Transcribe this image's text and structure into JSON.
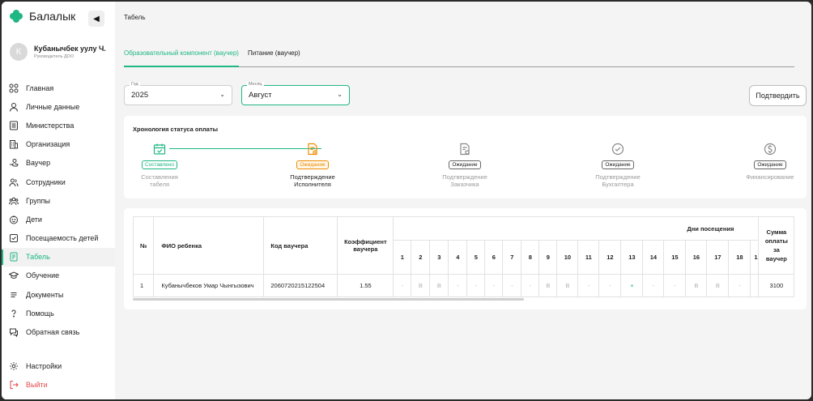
{
  "app": {
    "name": "Балалык"
  },
  "profile": {
    "initial": "К",
    "name": "Кубанычбек уулу Ч.",
    "role": "Руководитель ДОО"
  },
  "nav": {
    "items": [
      {
        "label": "Главная",
        "icon": "grid-icon"
      },
      {
        "label": "Личные данные",
        "icon": "user-icon"
      },
      {
        "label": "Министерства",
        "icon": "list-icon"
      },
      {
        "label": "Организация",
        "icon": "building-icon"
      },
      {
        "label": "Ваучер",
        "icon": "hand-icon"
      },
      {
        "label": "Сотрудники",
        "icon": "staff-icon"
      },
      {
        "label": "Группы",
        "icon": "group-icon"
      },
      {
        "label": "Дети",
        "icon": "child-icon"
      },
      {
        "label": "Посещаемость детей",
        "icon": "check-square-icon"
      },
      {
        "label": "Табель",
        "icon": "timesheet-icon",
        "active": true
      },
      {
        "label": "Обучение",
        "icon": "graduation-icon"
      },
      {
        "label": "Документы",
        "icon": "document-icon"
      },
      {
        "label": "Помощь",
        "icon": "help-icon"
      },
      {
        "label": "Обратная связь",
        "icon": "chat-icon"
      }
    ],
    "bottom": [
      {
        "label": "Настройки",
        "icon": "gear-icon"
      },
      {
        "label": "Выйти",
        "icon": "logout-icon"
      }
    ]
  },
  "breadcrumb": "Табель",
  "tabs": [
    {
      "label": "Образовательный компонент (ваучер)",
      "active": true
    },
    {
      "label": "Питание (ваучер)",
      "active": false
    }
  ],
  "filters": {
    "year": {
      "label": "Год",
      "value": "2025"
    },
    "month": {
      "label": "Месяц",
      "value": "Август"
    }
  },
  "confirm_button": "Подтвердить",
  "timeline": {
    "title": "Хронология статуса оплаты",
    "steps": [
      {
        "badge": "Составлено",
        "status": "done",
        "label_1": "Составления",
        "label_2": "табеля",
        "icon": "calendar-check-icon"
      },
      {
        "badge": "Ожидание",
        "status": "current",
        "label_1": "Подтверждение",
        "label_2": "Исполнителя",
        "icon": "document-pending-icon"
      },
      {
        "badge": "Ожидание",
        "status": "waiting",
        "label_1": "Подтверждение",
        "label_2": "Заказчика",
        "icon": "document-shield-icon"
      },
      {
        "badge": "Ожидание",
        "status": "waiting",
        "label_1": "Подтверждение",
        "label_2": "Бухгалтера",
        "icon": "check-circle-icon"
      },
      {
        "badge": "Ожидание",
        "status": "waiting",
        "label_1": "Финансирование",
        "label_2": "",
        "icon": "dollar-circle-icon"
      }
    ]
  },
  "table": {
    "headers": {
      "num": "№",
      "name": "ФИО ребенка",
      "voucher": "Код ваучера",
      "coef_1": "Коэффициент",
      "coef_2": "ваучера",
      "days": "Дни посещения",
      "sum_1": "Сумма",
      "sum_2": "оплаты",
      "sum_3": "за",
      "sum_4": "ваучер"
    },
    "days": [
      "1",
      "2",
      "3",
      "4",
      "5",
      "6",
      "7",
      "8",
      "9",
      "10",
      "11",
      "12",
      "13",
      "14",
      "15",
      "16",
      "17",
      "18",
      "1"
    ],
    "rows": [
      {
        "num": "1",
        "name": "Кубанычбеков Умар Чынгызович",
        "voucher": "2060720215122504",
        "coef": "1.55",
        "marks": [
          "-",
          "В",
          "В",
          "-",
          "-",
          "-",
          "-",
          "-",
          "В",
          "В",
          "-",
          "-",
          "+",
          "-",
          "-",
          "В",
          "В",
          "-",
          ""
        ],
        "sum": "3100"
      }
    ]
  },
  "colors": {
    "accent": "#1fb784",
    "pending": "#f08a00",
    "danger": "#e5484d"
  }
}
